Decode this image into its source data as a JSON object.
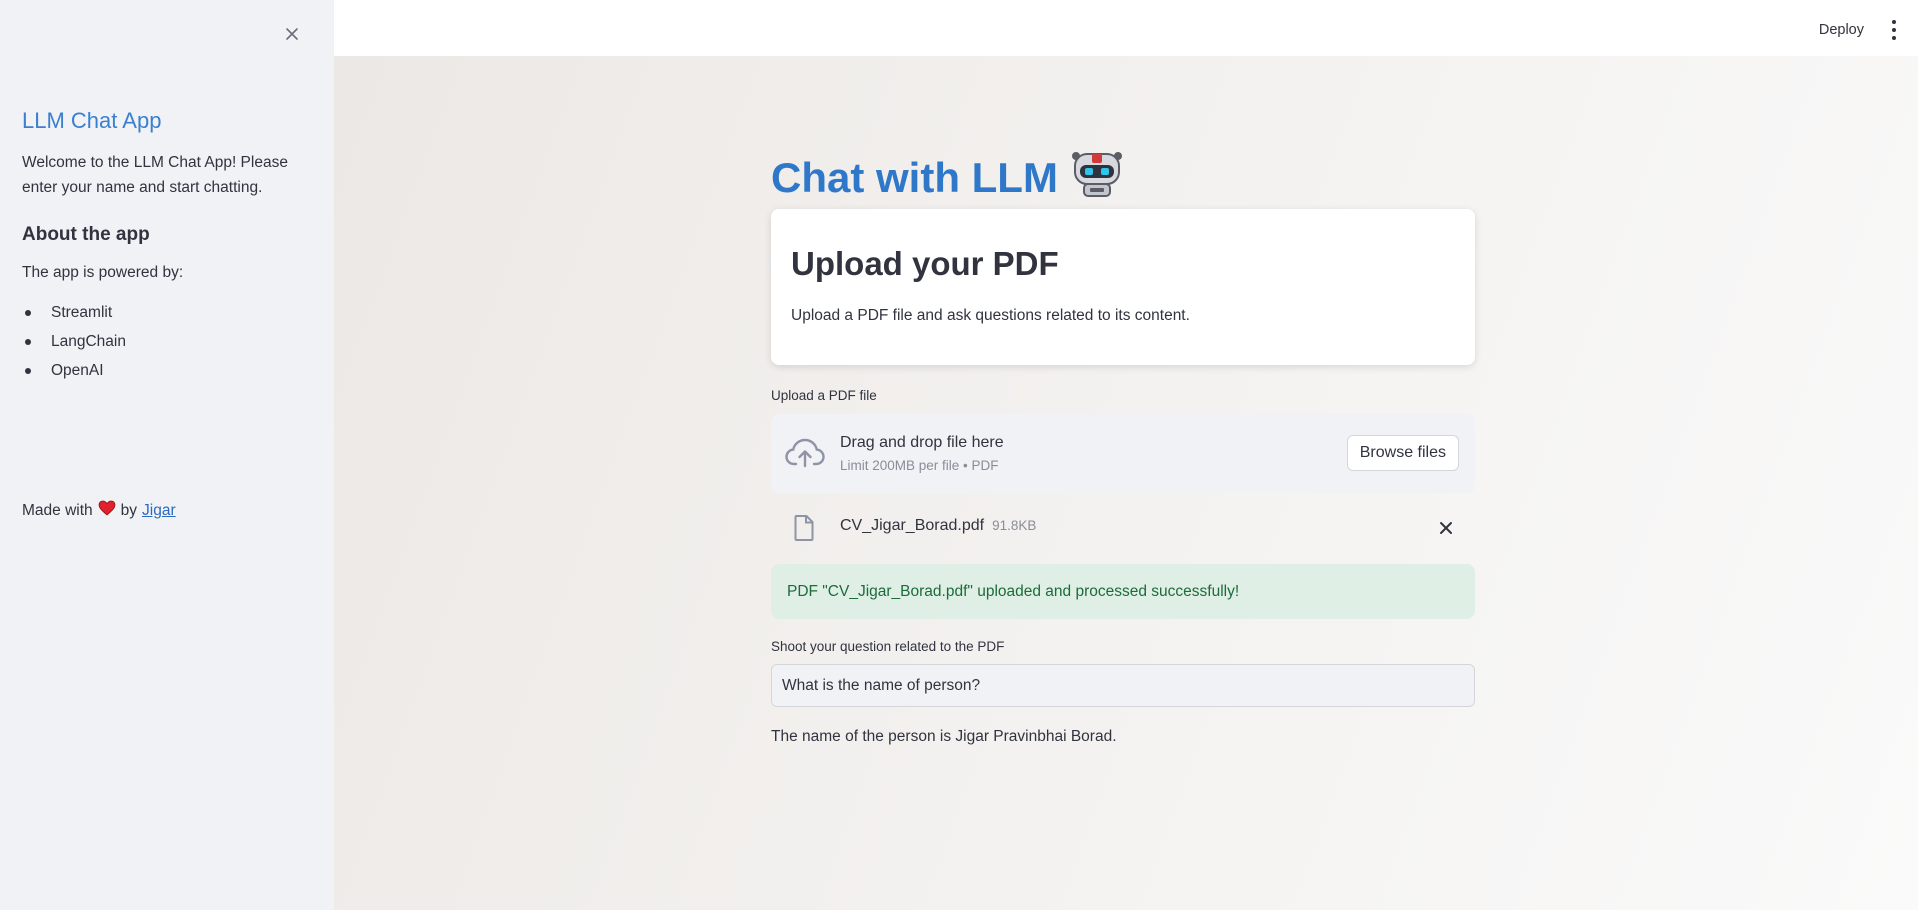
{
  "sidebar": {
    "title": "LLM Chat App",
    "welcome": "Welcome to the LLM Chat App! Please enter your name and start chatting.",
    "about_heading": "About the app",
    "powered_by": "The app is powered by:",
    "items": [
      {
        "label": "Streamlit"
      },
      {
        "label": "LangChain"
      },
      {
        "label": "OpenAI"
      }
    ],
    "footer": {
      "made_with": "Made with",
      "by": "by",
      "author_link": "Jigar"
    },
    "close_icon": "close-icon"
  },
  "header": {
    "deploy_label": "Deploy",
    "menu_icon": "kebab-menu-icon"
  },
  "main": {
    "title": "Chat with LLM",
    "title_emoji_icon": "robot-icon",
    "card": {
      "heading": "Upload your PDF",
      "description": "Upload a PDF file and ask questions related to its content."
    },
    "uploader": {
      "label": "Upload a PDF file",
      "drag_text": "Drag and drop file here",
      "limit_text": "Limit 200MB per file • PDF",
      "browse_label": "Browse files",
      "icon": "cloud-upload-icon"
    },
    "uploaded_file": {
      "name": "CV_Jigar_Borad.pdf",
      "size": "91.8KB",
      "icon": "file-icon"
    },
    "success_message": "PDF \"CV_Jigar_Borad.pdf\" uploaded and processed successfully!",
    "question": {
      "label": "Shoot your question related to the PDF",
      "value": "What is the name of person?"
    },
    "answer": "The name of the person is Jigar Pravinbhai Borad."
  },
  "colors": {
    "accent": "#2f78c9",
    "sidebar_bg": "#f0f2f6",
    "success_bg": "#dfefe5",
    "success_text": "#1c6b3a",
    "heart": "#e0212e"
  }
}
